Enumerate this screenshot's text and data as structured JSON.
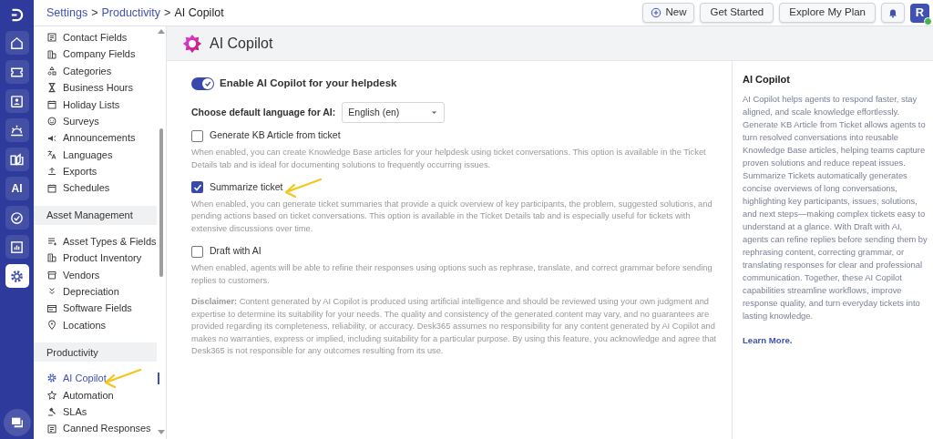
{
  "rail": [
    {
      "kind": "logo",
      "selected": false
    },
    {
      "kind": "home",
      "selected": false
    },
    {
      "kind": "ticket",
      "selected": false
    },
    {
      "kind": "contact",
      "selected": false
    },
    {
      "kind": "sun",
      "selected": false
    },
    {
      "kind": "book",
      "selected": false
    },
    {
      "kind": "text",
      "label": "AI",
      "selected": false
    },
    {
      "kind": "check",
      "selected": false
    },
    {
      "kind": "chart",
      "selected": false
    },
    {
      "kind": "gear",
      "selected": true
    }
  ],
  "breadcrumb": [
    {
      "kind": "link",
      "text": "Settings"
    },
    {
      "kind": "separator",
      "text": ">"
    },
    {
      "kind": "link",
      "text": "Productivity"
    },
    {
      "kind": "separator",
      "text": ">"
    },
    {
      "kind": "current",
      "text": "AI Copilot"
    }
  ],
  "top_buttons": [
    {
      "kind": "new",
      "label": "New"
    },
    {
      "kind": "plain",
      "label": "Get Started"
    },
    {
      "kind": "plain",
      "label": "Explore My Plan"
    },
    {
      "kind": "bell"
    }
  ],
  "avatar": {
    "initial": "R",
    "online": true
  },
  "sidebar": {
    "groups": [
      {
        "items": [
          {
            "label": "Contact Fields",
            "kind": "form",
            "selected": false
          },
          {
            "label": "Company Fields",
            "kind": "building",
            "selected": false
          },
          {
            "label": "Categories",
            "kind": "shapes",
            "selected": false
          },
          {
            "label": "Business Hours",
            "kind": "hourglass",
            "selected": false
          },
          {
            "label": "Holiday Lists",
            "kind": "calendar",
            "selected": false
          },
          {
            "label": "Surveys",
            "kind": "smile",
            "selected": false
          },
          {
            "label": "Announcements",
            "kind": "megaphone",
            "selected": false
          },
          {
            "label": "Languages",
            "kind": "translate",
            "selected": false
          },
          {
            "label": "Exports",
            "kind": "upload",
            "selected": false
          },
          {
            "label": "Schedules",
            "kind": "calendar",
            "selected": false
          }
        ]
      },
      {
        "title": "Asset Management",
        "items": [
          {
            "label": "Asset Types & Fields",
            "kind": "list",
            "selected": false
          },
          {
            "label": "Product Inventory",
            "kind": "building",
            "selected": false
          },
          {
            "label": "Vendors",
            "kind": "store",
            "selected": false
          },
          {
            "label": "Depreciation",
            "kind": "chevrons",
            "selected": false
          },
          {
            "label": "Software Fields",
            "kind": "window",
            "selected": false
          },
          {
            "label": "Locations",
            "kind": "pin",
            "selected": false
          }
        ]
      },
      {
        "title": "Productivity",
        "items": [
          {
            "label": "AI Copilot",
            "kind": "gear",
            "selected": true
          },
          {
            "label": "Automation",
            "kind": "star",
            "selected": false
          },
          {
            "label": "SLAs",
            "kind": "gavel",
            "selected": false
          },
          {
            "label": "Canned Responses",
            "kind": "form",
            "selected": false
          }
        ]
      }
    ]
  },
  "page": {
    "title": "AI Copilot",
    "toggle": {
      "label": "Enable AI Copilot for your helpdesk",
      "on": true
    },
    "language": {
      "label": "Choose default language for AI:",
      "value": "English (en)"
    },
    "options": [
      {
        "label": "Generate KB Article from ticket",
        "checked": false,
        "description": "When enabled, you can create Knowledge Base articles for your helpdesk using ticket conversations. This option is available in the Ticket Details tab and is ideal for documenting solutions to frequently occurring issues."
      },
      {
        "label": "Summarize ticket",
        "checked": true,
        "description": "When enabled, you can generate ticket summaries that provide a quick overview of key participants, the problem, suggested solutions, and pending actions based on ticket conversations. This option is available in the Ticket Details tab and is especially useful for tickets with extensive discussions over time."
      },
      {
        "label": "Draft with AI",
        "checked": false,
        "description": "When enabled, agents will be able to refine their responses using options such as rephrase, translate, and correct grammar before sending replies to customers."
      }
    ],
    "disclaimer": "**Disclaimer:** Content generated by AI Copilot is produced using artificial intelligence and should be reviewed using your own judgment and expertise to determine its suitability for your needs. The quality and consistency of the generated content may vary, and no guarantees are provided regarding its completeness, reliability, or accuracy. Desk365 assumes no responsibility for any content generated by AI Copilot and makes no warranties, express or implied, including suitability for a particular purpose. By using this feature, you acknowledge and agree that Desk365 is not responsible for any outcomes resulting from its use."
  },
  "help": {
    "title": "AI Copilot",
    "text": "AI Copilot helps agents to respond faster, stay aligned, and scale knowledge effortlessly. Generate KB Article from Ticket allows agents to turn resolved conversations into reusable Knowledge Base articles, helping teams capture proven solutions and reduce repeat issues. Summarize Tickets automatically generates concise overviews of long conversations, highlighting key participants, issues, solutions, and next steps—making complex tickets easy to understand at a glance. With Draft with AI, agents can refine replies before sending them by rephrasing content, correcting grammar, or translating responses for clear and professional communication. Together, these AI Copilot capabilities streamline workflows, improve response quality, and turn everyday tickets into lasting knowledge.",
    "link": "Learn More."
  }
}
